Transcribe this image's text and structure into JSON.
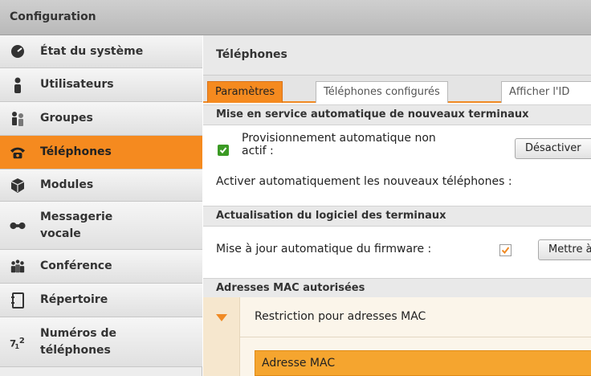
{
  "window": {
    "title": "Configuration"
  },
  "sidebar": {
    "items": [
      {
        "label": "État du système",
        "icon": "gauge-icon"
      },
      {
        "label": "Utilisateurs",
        "icon": "user-icon"
      },
      {
        "label": "Groupes",
        "icon": "group-icon"
      },
      {
        "label": "Téléphones",
        "icon": "phone-icon",
        "active": true
      },
      {
        "label": "Modules",
        "icon": "module-icon"
      },
      {
        "label": "Messagerie vocale",
        "icon": "voicemail-icon"
      },
      {
        "label": "Conférence",
        "icon": "conference-icon"
      },
      {
        "label": "Répertoire",
        "icon": "directory-icon"
      },
      {
        "label": "Numéros de téléphones",
        "icon": "numbers-icon"
      }
    ]
  },
  "main": {
    "title": "Téléphones",
    "tabs": [
      {
        "label": "Paramètres",
        "active": true
      },
      {
        "label": "Téléphones configurés",
        "active": false
      },
      {
        "label": "Afficher l'ID",
        "active": false
      }
    ],
    "provisioning": {
      "header": "Mise en service automatique de nouveaux terminaux",
      "status_line1": "Provisionnement automatique non",
      "status_line2": "actif :",
      "status_checked": true,
      "deactivate_button": "Désactiver",
      "auto_activate_label": "Activer automatiquement les nouveaux téléphones :"
    },
    "firmware": {
      "header": "Actualisation du logiciel des terminaux",
      "auto_update_label": "Mise à jour automatique du firmware :",
      "auto_update_checked": true,
      "update_button": "Mettre à jour"
    },
    "mac": {
      "header": "Adresses MAC autorisées",
      "restriction_label": "Restriction pour adresses MAC",
      "address_field_label": "Adresse MAC"
    }
  },
  "colors": {
    "accent": "#f58a1f",
    "check_green": "#3b9a24",
    "header_bg": "#e9e9e9"
  }
}
